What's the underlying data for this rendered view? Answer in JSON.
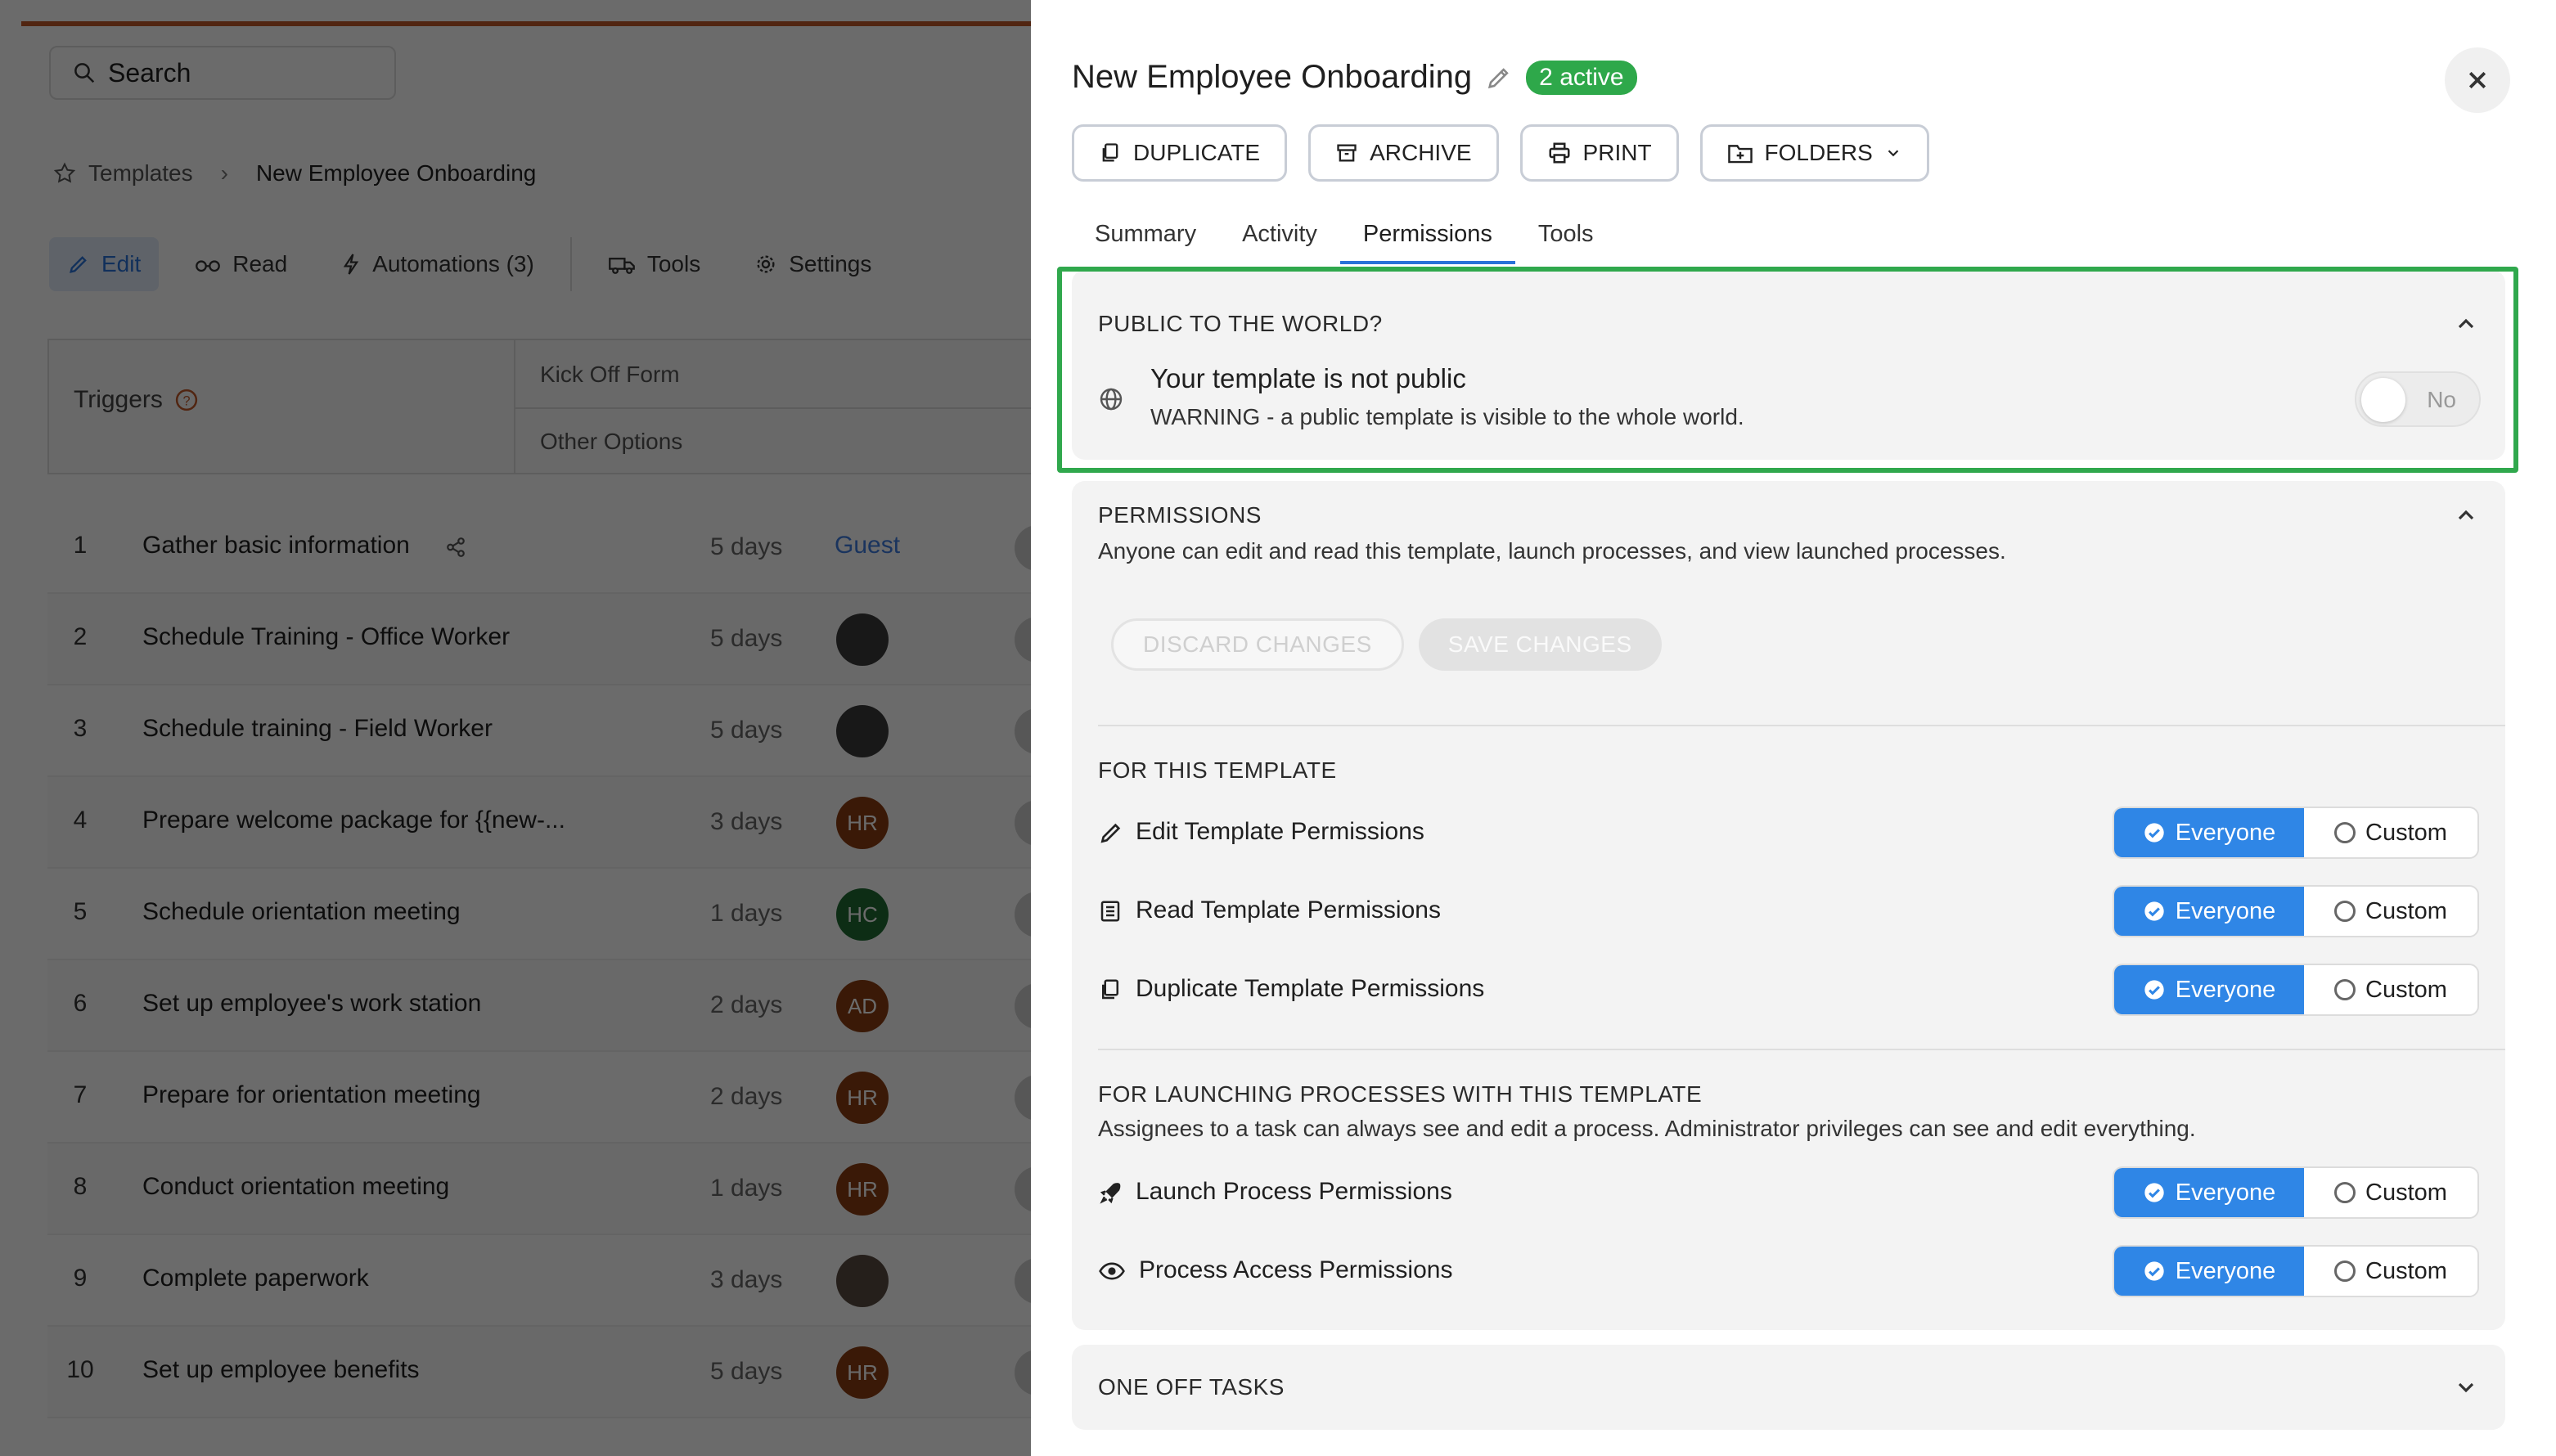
{
  "left": {
    "search_placeholder": "Search",
    "breadcrumb": {
      "root": "Templates",
      "current": "New Employee Onboarding"
    },
    "toolbar": [
      {
        "label": "Edit",
        "icon": "pencil-icon"
      },
      {
        "label": "Read",
        "icon": "glasses-icon"
      },
      {
        "label": "Automations (3)",
        "icon": "bolt-icon"
      },
      {
        "label": "Tools",
        "icon": "truck-icon"
      },
      {
        "label": "Settings",
        "icon": "gear-icon"
      }
    ],
    "triggers": {
      "label": "Triggers",
      "kick_off": "Kick Off Form",
      "other": "Other Options"
    },
    "tasks": [
      {
        "num": "1",
        "name": "Gather basic information",
        "duration": "5 days",
        "assignee": "Guest",
        "type": "guest"
      },
      {
        "num": "2",
        "name": "Schedule Training - Office Worker",
        "duration": "5 days",
        "assignee": "",
        "type": "photo",
        "color": "#3a3a3a"
      },
      {
        "num": "3",
        "name": "Schedule training - Field Worker",
        "duration": "5 days",
        "assignee": "",
        "type": "photo",
        "color": "#3a3a3a"
      },
      {
        "num": "4",
        "name": "Prepare welcome package for {{new-...",
        "duration": "3 days",
        "assignee": "HR",
        "type": "initials",
        "color": "#8a3d12"
      },
      {
        "num": "5",
        "name": "Schedule orientation meeting",
        "duration": "1 days",
        "assignee": "HC",
        "type": "initials",
        "color": "#1f6b34"
      },
      {
        "num": "6",
        "name": "Set up employee's work station",
        "duration": "2 days",
        "assignee": "AD",
        "type": "initials",
        "color": "#8a3d12"
      },
      {
        "num": "7",
        "name": "Prepare for orientation meeting",
        "duration": "2 days",
        "assignee": "HR",
        "type": "initials",
        "color": "#8a3d12"
      },
      {
        "num": "8",
        "name": "Conduct orientation meeting",
        "duration": "1 days",
        "assignee": "HR",
        "type": "initials",
        "color": "#8a3d12"
      },
      {
        "num": "9",
        "name": "Complete paperwork",
        "duration": "3 days",
        "assignee": "",
        "type": "photo",
        "color": "#5a4a40"
      },
      {
        "num": "10",
        "name": "Set up employee benefits",
        "duration": "5 days",
        "assignee": "HR",
        "type": "initials",
        "color": "#8a3d12"
      }
    ]
  },
  "panel": {
    "title": "New Employee Onboarding",
    "badge": "2 active",
    "actions": {
      "duplicate": "DUPLICATE",
      "archive": "ARCHIVE",
      "print": "PRINT",
      "folders": "FOLDERS"
    },
    "tabs": [
      "Summary",
      "Activity",
      "Permissions",
      "Tools"
    ],
    "active_tab": "Permissions",
    "public": {
      "heading": "PUBLIC TO THE WORLD?",
      "title": "Your template is not public",
      "warning": "WARNING - a public template is visible to the whole world.",
      "toggle_label": "No",
      "toggle_on": false
    },
    "permissions": {
      "heading": "PERMISSIONS",
      "description": "Anyone can edit and read this template, launch processes, and view launched processes.",
      "discard": "DISCARD CHANGES",
      "save": "SAVE CHANGES",
      "template_heading": "FOR THIS TEMPLATE",
      "launch_heading": "FOR LAUNCHING PROCESSES WITH THIS TEMPLATE",
      "launch_desc": "Assignees to a task can always see and edit a process. Administrator privileges can see and edit everything.",
      "option_on": "Everyone",
      "option_off": "Custom",
      "rows": {
        "edit": "Edit Template Permissions",
        "read": "Read Template Permissions",
        "duplicate": "Duplicate Template Permissions",
        "launch": "Launch Process Permissions",
        "access": "Process Access Permissions"
      }
    },
    "one_off": {
      "heading": "ONE OFF TASKS"
    },
    "colors": {
      "accent": "#2f86e6",
      "badge": "#2ea84a",
      "highlight": "#30a84d"
    }
  }
}
